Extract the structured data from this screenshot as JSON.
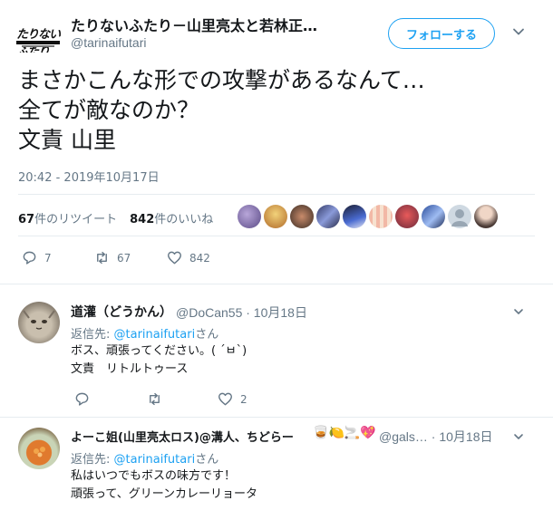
{
  "main_tweet": {
    "display_name": "たりないふたり－山里亮太と若林正…",
    "handle": "@tarinaifutari",
    "follow_label": "フォローする",
    "text_lines": [
      "まさかこんな形での攻撃があるなんて…",
      "全てが敵なのか？",
      "文責 山里"
    ],
    "timestamp": "20:42 - 2019年10月17日",
    "retweet_count": "67",
    "retweet_label": "件のリツイート",
    "like_count": "842",
    "like_label": "件のいいね",
    "actions": {
      "reply": "7",
      "retweet": "67",
      "like": "842"
    }
  },
  "replies": [
    {
      "display_name": "道灌（どうかん）",
      "meta": "@DoCan55 · 10月18日",
      "reply_to_prefix": "返信先: ",
      "reply_to_handle": "@tarinaifutari",
      "reply_to_suffix": "さん",
      "text_lines": [
        "ボス、頑張ってください。( ´ㅂ`)",
        "文責　リトルトゥース"
      ],
      "actions": {
        "reply": "",
        "retweet": "",
        "like": "2"
      }
    },
    {
      "display_name": "よーこ姐(山里亮太ロス)@溝人、ちどらー",
      "meta": "@gals… · 10月18日",
      "reply_to_prefix": "返信先: ",
      "reply_to_handle": "@tarinaifutari",
      "reply_to_suffix": "さん",
      "text_lines": [
        "私はいつでもボスの味方です！",
        "頑張って、グリーンカレーリョータ"
      ]
    }
  ],
  "logo_text": "たりないふたり",
  "colors": {
    "accent": "#1da1f2",
    "muted": "#657786",
    "text": "#14171a",
    "divider": "#e6ecf0"
  }
}
